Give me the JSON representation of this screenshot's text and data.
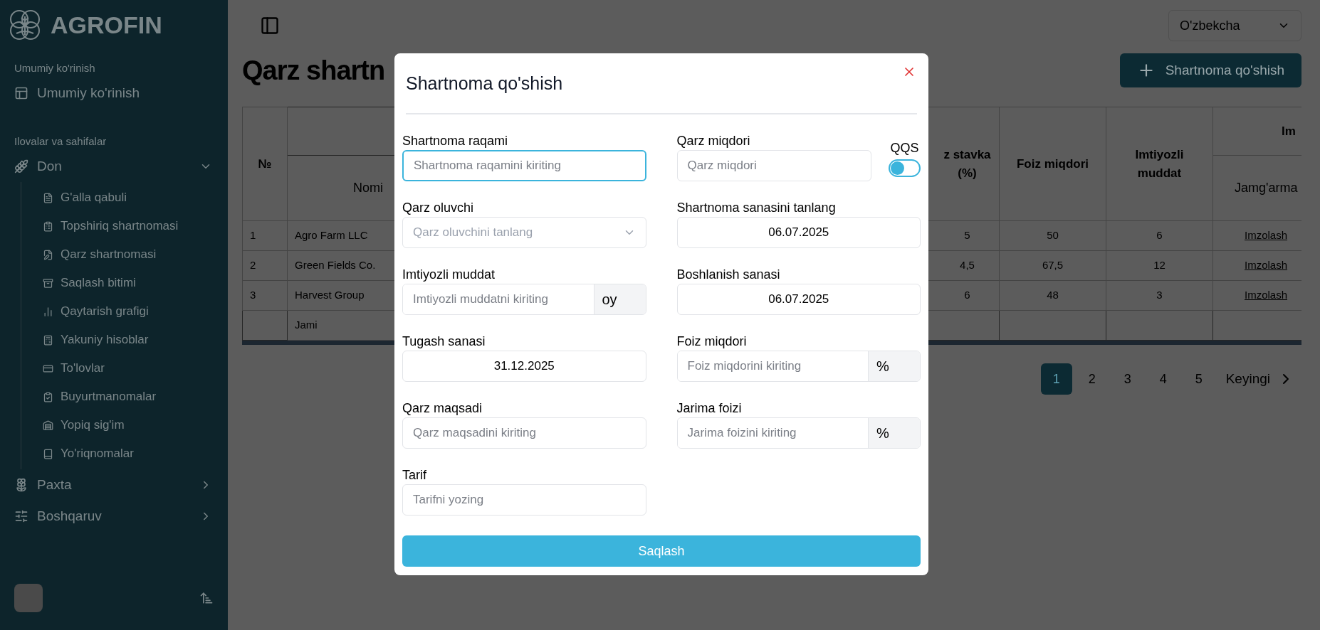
{
  "sidebar": {
    "logo": "AGROFIN",
    "sections": [
      {
        "label": "Umumiy ko'rinish",
        "items": [
          {
            "label": "Umumiy ko'rinish"
          }
        ]
      },
      {
        "label": "Ilovalar va sahifalar",
        "items": [
          {
            "label": "Don",
            "expanded": true,
            "children": [
              {
                "label": "G'alla qabuli"
              },
              {
                "label": "Topshiriq shartnomasi"
              },
              {
                "label": "Qarz shartnomasi"
              },
              {
                "label": "Saqlash bitimi"
              },
              {
                "label": "Qaytarish grafigi"
              },
              {
                "label": "Yakuniy hisoblar"
              },
              {
                "label": "To'lovlar"
              },
              {
                "label": "Buyurtmanomalar"
              },
              {
                "label": "Yopiq sig'im"
              },
              {
                "label": "Yo'riqnomalar"
              }
            ]
          },
          {
            "label": "Paxta",
            "expanded": false
          },
          {
            "label": "Boshqaruv",
            "expanded": false
          }
        ]
      }
    ]
  },
  "language": "O'zbekcha",
  "page_title": "Qarz shartn",
  "add_button": "Shartnoma qo'shish",
  "table": {
    "header": {
      "no": "№",
      "name": "Nomi",
      "rate": "z stavka (%)",
      "interest": "Foiz miqdori",
      "grace": "Imtiyozli muddat",
      "sign_group": "Im",
      "sign_sub": "Jamg'arma"
    },
    "rows": [
      {
        "no": "1",
        "name": "Agro Farm LLC",
        "rate": "5",
        "interest": "50",
        "grace": "6",
        "action": "Imzolash"
      },
      {
        "no": "2",
        "name": "Green Fields Co.",
        "rate": "4,5",
        "interest": "67,5",
        "grace": "12",
        "action": "Imzolash"
      },
      {
        "no": "3",
        "name": "Harvest Group",
        "rate": "6",
        "interest": "48",
        "grace": "3",
        "action": "Imzolash"
      }
    ],
    "total": {
      "name": "Jami"
    }
  },
  "pagination": {
    "pages": [
      {
        "label": "1",
        "selected": true
      },
      {
        "label": "2",
        "selected": false
      },
      {
        "label": "3",
        "selected": false
      },
      {
        "label": "4",
        "selected": false
      },
      {
        "label": "5",
        "selected": false
      }
    ],
    "next": "Keyingi"
  },
  "modal": {
    "title": "Shartnoma qo'shish",
    "save": "Saqlash",
    "left": [
      {
        "kind": "text",
        "label": "Shartnoma raqami",
        "placeholder": "Shartnoma raqamini kiriting",
        "focused": true
      },
      {
        "kind": "select",
        "label": "Qarz oluvchi",
        "placeholder": "Qarz oluvchini tanlang"
      },
      {
        "kind": "suffix",
        "label": "Imtiyozli muddat",
        "placeholder": "Imtiyozli muddatni kiriting",
        "suffix": "oy",
        "focused": false
      },
      {
        "kind": "date",
        "label": "Tugash sanasi",
        "value": "31.12.2025"
      },
      {
        "kind": "text",
        "label": "Qarz maqsadi",
        "placeholder": "Qarz maqsadini kiriting",
        "focused": false
      },
      {
        "kind": "text",
        "label": "Tarif",
        "placeholder": "Tarifni yozing",
        "focused": false
      }
    ],
    "right": [
      {
        "kind": "toggle_text",
        "label": "Qarz miqdori",
        "placeholder": "Qarz miqdori",
        "focused": false,
        "toggle": {
          "label": "QQS",
          "on": false
        }
      },
      {
        "kind": "date",
        "label": "Shartnoma sanasini tanlang",
        "value": "06.07.2025"
      },
      {
        "kind": "date",
        "label": "Boshlanish sanasi",
        "value": "06.07.2025"
      },
      {
        "kind": "suffix",
        "label": "Foiz miqdori",
        "placeholder": "Foiz miqdorini kiriting",
        "suffix": "%",
        "focused": false
      },
      {
        "kind": "suffix",
        "label": "Jarima foizi",
        "placeholder": "Jarima foizini kiriting",
        "suffix": "%",
        "focused": false
      }
    ]
  }
}
